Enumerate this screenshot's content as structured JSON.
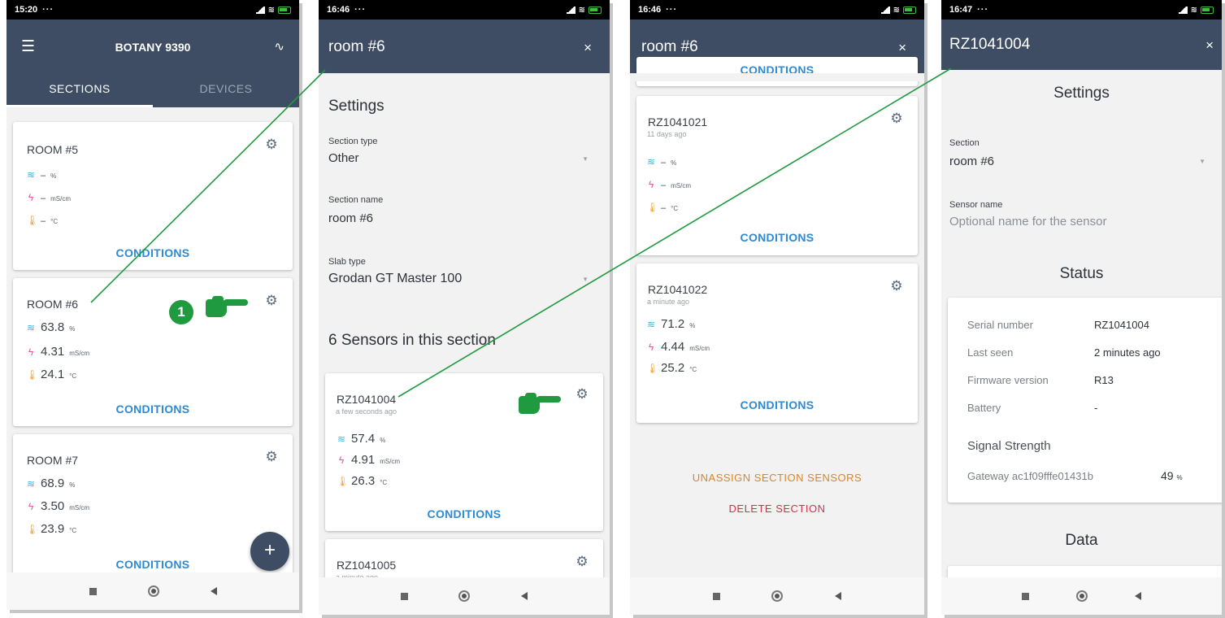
{
  "panels": [
    {
      "status_time": "15:20",
      "status_dots": "···",
      "menu_icon": "hamburger-icon",
      "title": "BOTANY 9390",
      "activity_icon": "pulse-icon",
      "tabs": [
        "SECTIONS",
        "DEVICES"
      ],
      "cards": [
        {
          "name": "ROOM #5",
          "moisture": "–",
          "moisture_unit": "%",
          "ec": "–",
          "ec_unit": "mS/cm",
          "temp": "–",
          "temp_unit": "°C",
          "conditions": "CONDITIONS"
        },
        {
          "name": "ROOM #6",
          "moisture": "63.8",
          "moisture_unit": "%",
          "ec": "4.31",
          "ec_unit": "mS/cm",
          "temp": "24.1",
          "temp_unit": "°C",
          "conditions": "CONDITIONS"
        },
        {
          "name": "ROOM #7",
          "moisture": "68.9",
          "moisture_unit": "%",
          "ec": "3.50",
          "ec_unit": "mS/cm",
          "temp": "23.9",
          "temp_unit": "°C",
          "conditions": "CONDITIONS"
        }
      ],
      "step_badge": "1",
      "fab_label": "+"
    },
    {
      "status_time": "16:46",
      "status_dots": "···",
      "title": "room #6",
      "close": "×",
      "settings_heading": "Settings",
      "section_type_label": "Section type",
      "section_type_value": "Other",
      "section_name_label": "Section name",
      "section_name_value": "room #6",
      "slab_type_label": "Slab type",
      "slab_type_value": "Grodan GT Master 100",
      "sensors_heading": "6 Sensors in this section",
      "sensors": [
        {
          "id": "RZ1041004",
          "ago": "a few seconds ago",
          "moisture": "57.4",
          "moisture_unit": "%",
          "ec": "4.91",
          "ec_unit": "mS/cm",
          "temp": "26.3",
          "temp_unit": "°C",
          "conditions": "CONDITIONS"
        },
        {
          "id": "RZ1041005",
          "ago": "a minute ago"
        }
      ]
    },
    {
      "status_time": "16:46",
      "status_dots": "···",
      "title": "room #6",
      "close": "×",
      "top_conditions": "CONDITIONS",
      "sensors": [
        {
          "id": "RZ1041021",
          "ago": "11 days ago",
          "moisture": "–",
          "moisture_unit": "%",
          "ec": "–",
          "ec_unit": "mS/cm",
          "temp": "–",
          "temp_unit": "°C",
          "conditions": "CONDITIONS"
        },
        {
          "id": "RZ1041022",
          "ago": "a minute ago",
          "moisture": "71.2",
          "moisture_unit": "%",
          "ec": "4.44",
          "ec_unit": "mS/cm",
          "temp": "25.2",
          "temp_unit": "°C",
          "conditions": "CONDITIONS"
        }
      ],
      "unassign_label": "UNASSIGN SECTION SENSORS",
      "delete_label": "DELETE SECTION"
    },
    {
      "status_time": "16:47",
      "status_dots": "···",
      "title": "RZ1041004",
      "close": "×",
      "settings_heading": "Settings",
      "section_label": "Section",
      "section_value": "room #6",
      "sensor_name_label": "Sensor name",
      "sensor_name_placeholder": "Optional name for the sensor",
      "status_heading": "Status",
      "serial_label": "Serial number",
      "serial_value": "RZ1041004",
      "last_seen_label": "Last seen",
      "last_seen_value": "2 minutes ago",
      "firmware_label": "Firmware version",
      "firmware_value": "R13",
      "battery_label": "Battery",
      "battery_value": "-",
      "signal_heading": "Signal Strength",
      "gateway_label": "Gateway ac1f09fffe01431b",
      "gateway_value": "49",
      "gateway_unit": "%",
      "data_heading": "Data"
    }
  ],
  "colors": {
    "appbar": "#3e4d63",
    "conditions_link": "#2d8ad4",
    "annotation_green": "#1f9a3e",
    "unassign": "#d8862a",
    "delete": "#d0344a"
  }
}
